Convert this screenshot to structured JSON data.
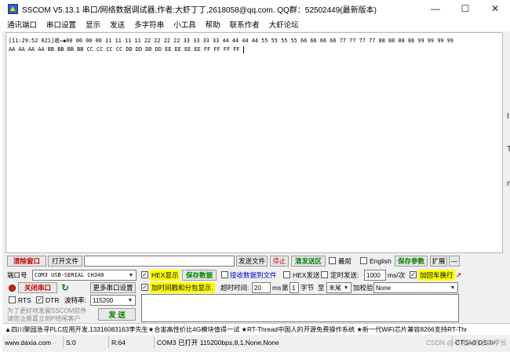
{
  "title": "SSCOM V5.13.1 串口/网络数据调试器,作者:大虾丁丁,2618058@qq.com. QQ群：52502449(最新版本)",
  "menu": [
    "通讯端口",
    "串口设置",
    "显示",
    "发送",
    "多字符串",
    "小工具",
    "帮助",
    "联系作者",
    "大虾论坛"
  ],
  "receive": {
    "line1": "[11:29:52 021]收←◆00 00 00 00 11 11 11 11 22 22 22 22 33 33 33 33 44 44 44 44 55 55 55 55 66 66 66 66 77 77 77 77 88 88 88 88 99 99 99 99",
    "line2": "AA AA AA AA BB BB BB BB CC CC CC CC DD DD DD DD EE EE EE EE FF FF FF FF "
  },
  "side_glyphs": [
    "t",
    "T",
    "n"
  ],
  "row1": {
    "clear_window": "清除窗口",
    "open_file": "打开文件",
    "file_path": "",
    "send_file": "发送文件",
    "stop": "停止",
    "clear_send": "清发送区",
    "latest_label": "最前",
    "english_label": "English",
    "save_params": "保存参数",
    "expand": "扩展",
    "collapse": "—"
  },
  "row2": {
    "port_label": "端口号",
    "port_value": "COM3 USB-SERIAL CH340",
    "hex_display": "HEX显示",
    "save_data": "保存数据",
    "recv_to_file": "接收数据到文件",
    "hex_send": "HEX发送",
    "timed_send": "定时发送:",
    "interval_value": "1000",
    "interval_unit": "ms/次",
    "append_crlf": "加回车换行"
  },
  "row3": {
    "close_port": "关闭串口",
    "more_settings": "更多串口设置",
    "timestamp_split": "加时间戳和分包显示.",
    "timeout_label": "超时时间:",
    "timeout_value": "20",
    "timeout_unit": "ms",
    "byte_prefix": "第",
    "byte_value": "1",
    "byte_label": "字节",
    "to_label": "至",
    "to_value": "末尾",
    "checksum_label": "加校验",
    "checksum_value": "None"
  },
  "row4": {
    "rts": "RTS",
    "dtr": "DTR",
    "baud_label": "波特率:",
    "baud_value": "115200"
  },
  "promo_line1": "为了更好地发展SSCOM软件",
  "promo_line2": "请您注册嘉立创P结尾客户",
  "send_button": "发 送",
  "ticker": "▲四川聚园急寻PLC应用开发,13316083163李先生★合宙高性价比4G模块值得一试 ★RT-Thread中国人的开源免费操作系统 ★新一代WiFi芯片兼容8266支持RT-Thr",
  "status": {
    "url": "www.daxia.com",
    "sent": "S:0",
    "received": "R:64",
    "port_state": "COM3 已打开  115200bps,8,1,None,None",
    "watermark": "CSDN @不秃头的小白学长",
    "cts": "CTS=0 DSR="
  },
  "colors": {
    "highlight_yellow": "#ffff00",
    "red_text": "#c00000",
    "green_text": "#008000"
  }
}
